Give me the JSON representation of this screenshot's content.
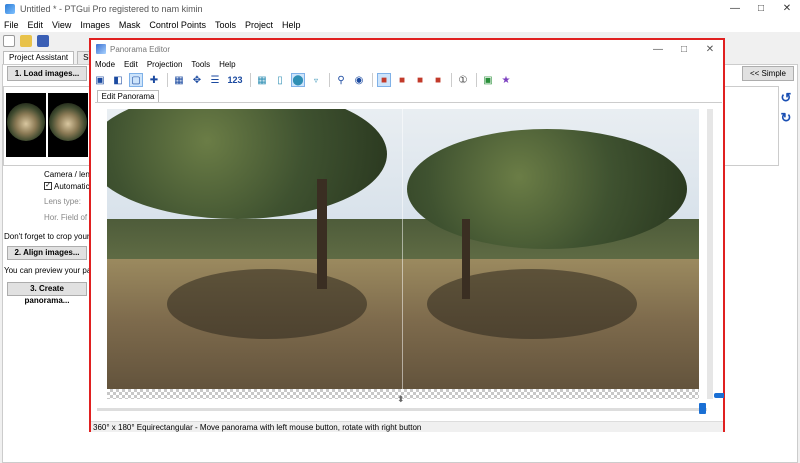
{
  "main_window": {
    "title": "Untitled * - PTGui Pro registered to nam kimin",
    "menu": [
      "File",
      "Edit",
      "View",
      "Images",
      "Mask",
      "Control Points",
      "Tools",
      "Project",
      "Help"
    ],
    "tabs": [
      "Project Assistant",
      "Source"
    ],
    "load_button": "1. Load images...",
    "simple_button": "<< Simple",
    "camera_lens_label": "Camera / lens",
    "automatic_label": "Automatic",
    "lens_type_label": "Lens type:",
    "hfov_label": "Hor. Field of V",
    "crop_hint": "Don't forget to crop your ima",
    "align_button": "2. Align images...",
    "preview_hint": "You can preview your panor",
    "create_button": "3. Create panorama..."
  },
  "editor_window": {
    "title": "Panorama Editor",
    "menu": [
      "Mode",
      "Edit",
      "Projection",
      "Tools",
      "Help"
    ],
    "toolbar_number": "123",
    "tab": "Edit Panorama",
    "status": "360° x 180° Equirectangular - Move panorama with left mouse button, rotate with right button"
  },
  "icons": {
    "minimize": "minimize-icon",
    "maximize": "maximize-icon",
    "close": "close-icon"
  },
  "colors": {
    "highlight_border": "#e02020",
    "accent_blue": "#1a6fd4"
  }
}
